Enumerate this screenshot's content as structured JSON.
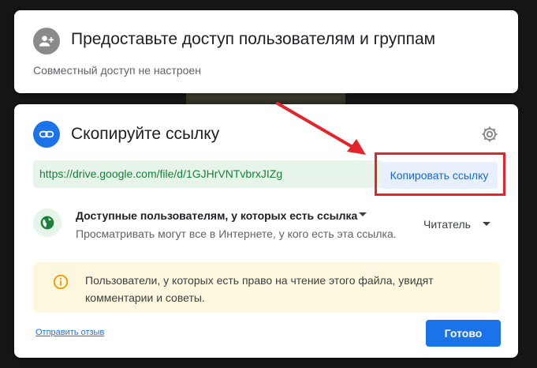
{
  "share_card": {
    "title": "Предоставьте доступ пользователям и группам",
    "status": "Совместный доступ не настроен",
    "icon": "person-add-icon"
  },
  "link_card": {
    "title": "Скопируйте ссылку",
    "icon": "link-icon",
    "settings_icon": "gear-icon",
    "url": "https://drive.google.com/file/d/1GJHrVNTvbrxJIZg",
    "copy_button": "Копировать ссылку",
    "access": {
      "title": "Доступные пользователям, у которых есть ссылка",
      "description": "Просматривать могут все в Интернете, у кого есть эта ссылка.",
      "role": "Читатель",
      "icon": "globe-icon"
    },
    "info": {
      "text": "Пользователи, у которых есть право на чтение этого файла, увидят комментарии и советы.",
      "icon": "info-icon"
    },
    "feedback_link": "Отправить отзыв",
    "done_button": "Готово"
  },
  "annotation": {
    "color": "#e3242b"
  },
  "colors": {
    "accent": "#1a73e8",
    "url_text": "#188038",
    "url_bg": "#e6f4ea",
    "info_bg": "#fef7e0"
  }
}
